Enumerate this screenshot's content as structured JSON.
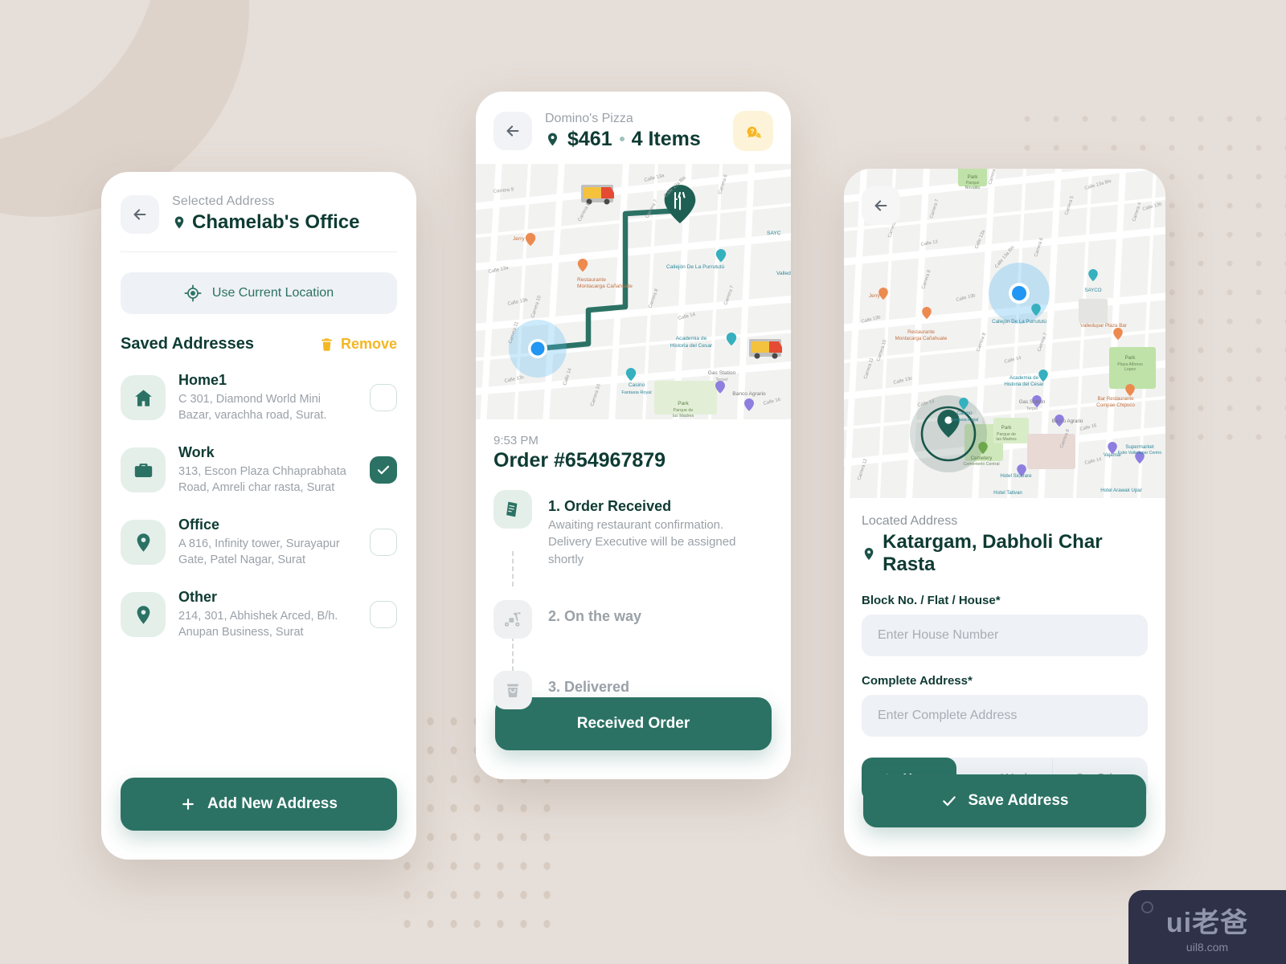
{
  "screen_address": {
    "back_icon": "arrow-left-icon",
    "eyebrow": "Selected Address",
    "title": "Chamelab's Office",
    "current_location_label": "Use Current Location",
    "current_location_icon": "gps-target-icon",
    "saved_title": "Saved Addresses",
    "remove_label": "Remove",
    "remove_icon": "trash-icon",
    "addresses": [
      {
        "icon": "home-icon",
        "label": "Home1",
        "text": "C 301, Diamond World Mini Bazar,  varachha road, Surat.",
        "selected": false
      },
      {
        "icon": "briefcase-icon",
        "label": "Work",
        "text": "313, Escon Plaza Chhaprabhata Road, Amreli char rasta, Surat",
        "selected": true
      },
      {
        "icon": "map-pin-icon",
        "label": "Office",
        "text": "A 816, Infinity tower, Surayapur Gate, Patel Nagar, Surat",
        "selected": false
      },
      {
        "icon": "map-pin-icon",
        "label": "Other",
        "text": "214, 301, Abhishek Arced, B/h. Anupan Business, Surat",
        "selected": false
      }
    ],
    "add_button_label": "Add New Address",
    "add_button_icon": "plus-icon"
  },
  "screen_tracking": {
    "back_icon": "arrow-left-icon",
    "shop": "Domino's Pizza",
    "price": "$461",
    "items": "4 Items",
    "location_icon": "map-pin-icon",
    "help_icon": "help-chat-icon",
    "time": "9:53 PM",
    "order_id": "Order #654967879",
    "steps": [
      {
        "icon": "receipt-icon",
        "title": "1. Order Received",
        "sub_line_1": "Awaiting  restaurant  confirmation.",
        "sub_line_2": "Delivery Executive will be assigned shortly",
        "state": "active"
      },
      {
        "icon": "scooter-icon",
        "title": "2. On the way",
        "state": "idle"
      },
      {
        "icon": "bag-icon",
        "title": "3. Delivered",
        "state": "idle"
      }
    ],
    "cta_label": "Received Order",
    "map_labels": {
      "restaurant_pin_icon": "restaurant-fork-knife-pin",
      "user_dot": "current-location-dot",
      "places": [
        "Jerry",
        "Restaurante Montacarga Cañahuate",
        "Callejón De La Purrututú",
        "Academia de Historia del Cesar",
        "Casino Fantasia Royal",
        "Gas Station Terpel",
        "Banco Agrario",
        "Park Parque de las Madres"
      ],
      "streets": [
        "Carrera 9",
        "Carrera 8",
        "Carrera 7",
        "Calle 13a",
        "Calle 13b",
        "Calle 14",
        "Carrera 10",
        "Carrera 11",
        "Calle 16",
        "Carrera 6"
      ]
    }
  },
  "screen_locate": {
    "back_icon": "arrow-left-icon",
    "eyebrow": "Located Address",
    "title": "Katargam, Dabholi Char Rasta",
    "location_icon": "map-pin-icon",
    "block_label": "Block No. / Flat / House*",
    "block_placeholder": "Enter House Number",
    "block_value": "",
    "complete_label": "Complete Address*",
    "complete_placeholder": "Enter Complete Address",
    "complete_value": "",
    "segments": [
      {
        "label": "Home",
        "icon": "home-icon",
        "active": true
      },
      {
        "label": "Work",
        "icon": "briefcase-icon",
        "active": false
      },
      {
        "label": "Other",
        "icon": "map-pin-icon",
        "active": false
      }
    ],
    "cta_label": "Save Address",
    "cta_icon": "check-icon",
    "map_labels": {
      "places": [
        "Park Parque Novalito",
        "SAYCO",
        "Jerry",
        "Restaurante Montacarga Cañahuate",
        "Callejón De La Purrututú",
        "Valledupar Plaza Bar",
        "Park Plaza Alfonso Lopez",
        "Academia de Historia del Cesar",
        "Bar Restaurante Compae Chipuco",
        "Gas Station Terpel",
        "Banco Agrario",
        "Casino Fantasia Royal",
        "Park Parque de las Madres",
        "Supermarket Exito Valledupar Centro",
        "Cemetery Cementerio Central",
        "Hotel Sicarare",
        "Vajamar",
        "Hotel Tativan",
        "Hotel Arawak Upar"
      ],
      "streets": [
        "Carrera 7",
        "Carrera 6",
        "Carrera 5",
        "Carrera 4",
        "Carrera 8",
        "Carrera 9",
        "Carrera 10",
        "Carrera 11",
        "Carrera 12",
        "Calle 13",
        "Calle 13a",
        "Calle 13a Bis",
        "Calle 13b",
        "Calle 14",
        "Calle 16"
      ]
    }
  },
  "watermark": {
    "main": "ui老爸",
    "sub": "uil8.com"
  },
  "colors": {
    "brand_green": "#2b7264",
    "dark_green": "#0e3b33",
    "accent_yellow": "#f5b623",
    "page_bg": "#e6ded8",
    "field_bg": "#eef1f5",
    "muted_text": "#9aa1a8"
  }
}
